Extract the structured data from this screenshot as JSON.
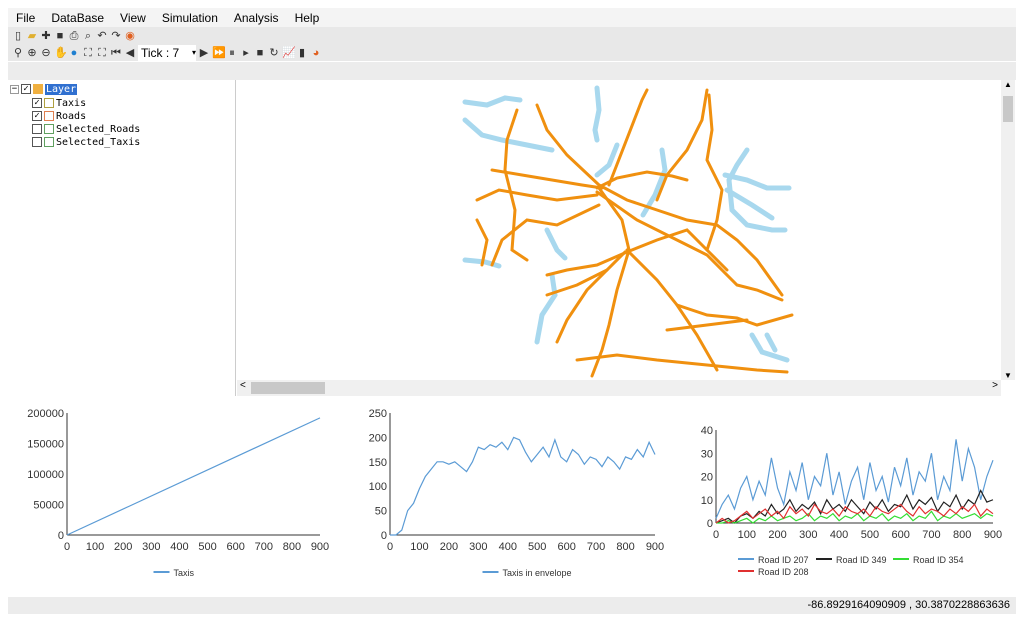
{
  "menu": [
    "File",
    "DataBase",
    "View",
    "Simulation",
    "Analysis",
    "Help"
  ],
  "toolbar": {
    "tick_label": "Tick : 7",
    "icons1": [
      "new-icon",
      "open-icon",
      "add-icon",
      "save-icon",
      "print-icon",
      "find-icon",
      "undo-icon",
      "redo-icon",
      "color-icon"
    ],
    "icons2": [
      "zoom-icon",
      "zoom-in-icon",
      "zoom-out-icon",
      "pan-icon",
      "globe-icon",
      "full-extent-icon",
      "fit-icon",
      "first-icon",
      "prev-icon"
    ],
    "icons3": [
      "next-icon",
      "fast-forward-icon",
      "pause-icon",
      "play-icon",
      "stop-icon",
      "refresh-icon",
      "line-chart-icon",
      "bar-chart-icon",
      "pie-chart-icon"
    ]
  },
  "tree": {
    "root": "Layer",
    "layers": [
      {
        "name": "Taxis",
        "checked": true
      },
      {
        "name": "Roads",
        "checked": true
      },
      {
        "name": "Selected_Roads",
        "checked": false
      },
      {
        "name": "Selected_Taxis",
        "checked": false
      }
    ]
  },
  "colors": {
    "road": "#f0900f",
    "taxi_road": "#a8d8ee",
    "s207": "#5b9bd5",
    "s349": "#222222",
    "s354": "#33dd33",
    "s208": "#e03030"
  },
  "status": {
    "coords": "-86.8929164090909 , 30.3870228863636"
  },
  "chart_data": [
    {
      "type": "line",
      "title": "",
      "xlim": [
        0,
        900
      ],
      "ylim": [
        0,
        200000
      ],
      "xticks": [
        "0",
        "100",
        "200",
        "300",
        "400",
        "500",
        "600",
        "700",
        "800",
        "900"
      ],
      "yticks": [
        "0",
        "50000",
        "100000",
        "150000",
        "200000"
      ],
      "x": [
        0,
        900
      ],
      "series": [
        {
          "name": "Taxis",
          "values": [
            0,
            192000
          ],
          "color": "#5b9bd5"
        }
      ],
      "legend": "bottom"
    },
    {
      "type": "line",
      "title": "",
      "xlim": [
        0,
        900
      ],
      "ylim": [
        0,
        250
      ],
      "xticks": [
        "0",
        "100",
        "200",
        "300",
        "400",
        "500",
        "600",
        "700",
        "800",
        "900"
      ],
      "yticks": [
        "0",
        "50",
        "100",
        "150",
        "200",
        "250"
      ],
      "x_step": 20,
      "series": [
        {
          "name": "Taxis in envelope",
          "color": "#5b9bd5",
          "values": [
            0,
            0,
            10,
            50,
            65,
            95,
            120,
            135,
            150,
            150,
            145,
            150,
            140,
            130,
            150,
            180,
            175,
            185,
            180,
            190,
            175,
            200,
            195,
            170,
            150,
            165,
            180,
            160,
            195,
            160,
            150,
            175,
            165,
            145,
            160,
            155,
            140,
            160,
            150,
            135,
            160,
            155,
            175,
            160,
            190,
            165
          ]
        }
      ],
      "legend": "bottom"
    },
    {
      "type": "line",
      "title": "",
      "xlim": [
        0,
        900
      ],
      "ylim": [
        0,
        40
      ],
      "xticks": [
        "0",
        "100",
        "200",
        "300",
        "400",
        "500",
        "600",
        "700",
        "800",
        "900"
      ],
      "yticks": [
        "0",
        "10",
        "20",
        "30",
        "40"
      ],
      "x_step": 20,
      "series": [
        {
          "name": "Road ID 207",
          "color": "#5b9bd5",
          "values": [
            2,
            8,
            12,
            6,
            15,
            20,
            10,
            18,
            12,
            28,
            15,
            8,
            22,
            14,
            26,
            10,
            20,
            16,
            30,
            12,
            22,
            8,
            18,
            24,
            10,
            26,
            14,
            20,
            9,
            24,
            16,
            28,
            12,
            22,
            18,
            30,
            10,
            20,
            14,
            36,
            18,
            32,
            24,
            10,
            20,
            27
          ]
        },
        {
          "name": "Road ID 349",
          "color": "#222222",
          "values": [
            0,
            1,
            2,
            0,
            3,
            4,
            2,
            5,
            3,
            8,
            4,
            6,
            10,
            5,
            8,
            6,
            9,
            4,
            10,
            6,
            8,
            5,
            10,
            7,
            4,
            9,
            6,
            10,
            5,
            8,
            7,
            12,
            6,
            10,
            8,
            11,
            5,
            9,
            7,
            12,
            6,
            10,
            8,
            14,
            9,
            10
          ]
        },
        {
          "name": "Road ID 354",
          "color": "#33dd33",
          "values": [
            0,
            0,
            1,
            0,
            1,
            2,
            0,
            2,
            1,
            3,
            1,
            2,
            3,
            1,
            2,
            4,
            1,
            3,
            2,
            4,
            1,
            3,
            2,
            4,
            1,
            3,
            2,
            4,
            1,
            3,
            2,
            4,
            1,
            3,
            2,
            5,
            1,
            3,
            2,
            4,
            2,
            3,
            4,
            2,
            4,
            3
          ]
        },
        {
          "name": "Road ID 208",
          "color": "#e03030",
          "values": [
            0,
            2,
            0,
            1,
            3,
            5,
            2,
            4,
            6,
            3,
            5,
            2,
            7,
            4,
            6,
            3,
            8,
            5,
            4,
            6,
            3,
            7,
            5,
            4,
            6,
            3,
            7,
            5,
            4,
            6,
            8,
            5,
            3,
            7,
            4,
            6,
            5,
            3,
            6,
            4,
            7,
            5,
            8,
            3,
            6,
            4
          ]
        }
      ],
      "legend": "bottom"
    }
  ]
}
